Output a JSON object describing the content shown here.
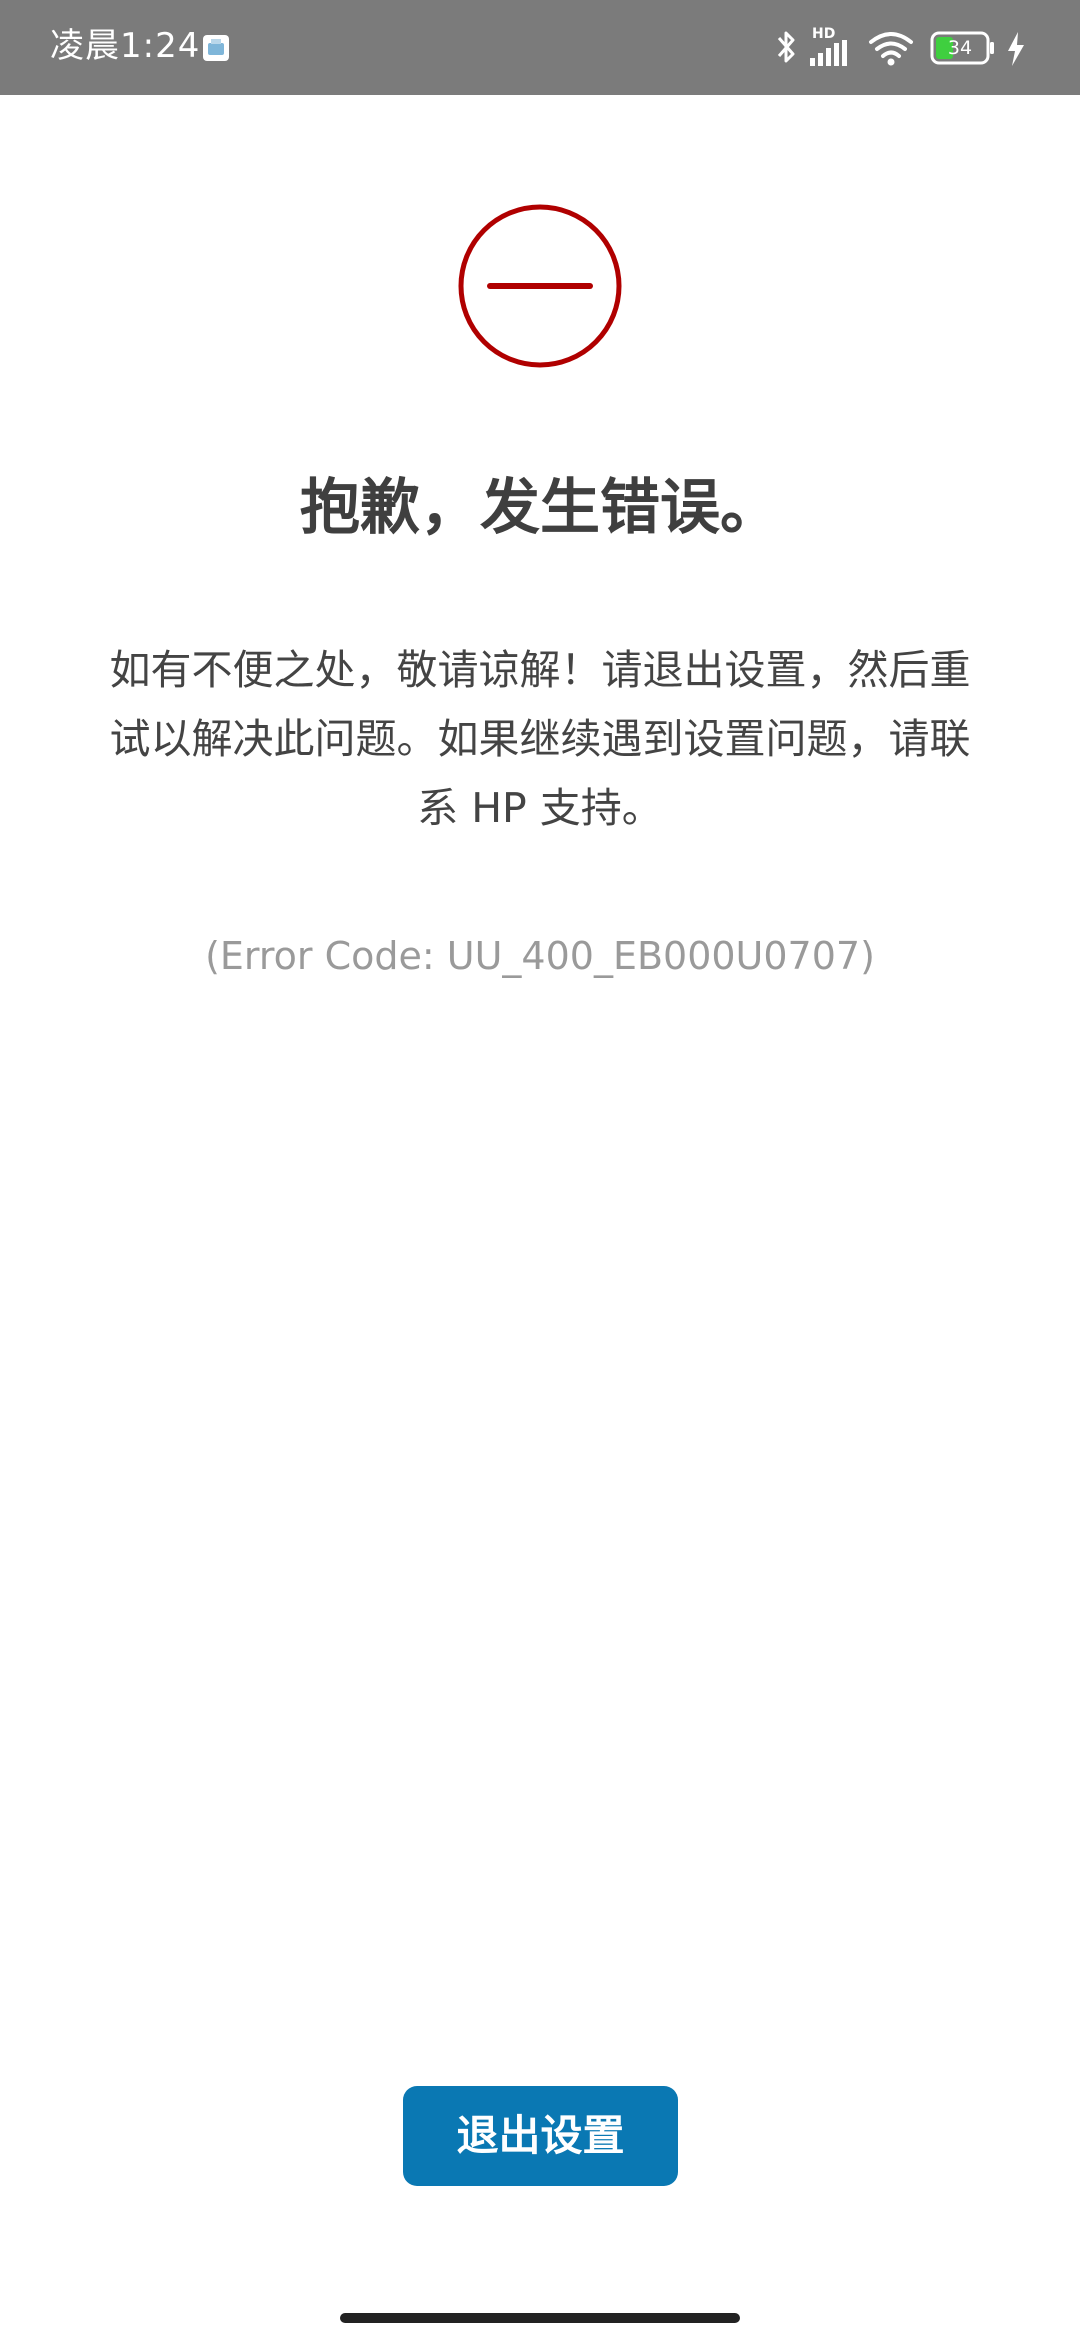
{
  "status_bar": {
    "time": "凌晨1:24",
    "battery_level": "34",
    "network_label": "HD",
    "icons": [
      "notification-app-icon",
      "bluetooth-icon",
      "signal-icon",
      "wifi-icon",
      "battery-icon",
      "charging-icon"
    ],
    "battery_color": "#3fcf3f"
  },
  "error": {
    "icon": "minus-circle-icon",
    "icon_color": "#b00000",
    "title": "抱歉，发生错误。",
    "message": "如有不便之处，敬请谅解！请退出设置，然后重试以解决此问题。如果继续遇到设置问题，请联系 HP 支持。",
    "code": "(Error Code: UU_400_EB000U0707)"
  },
  "actions": {
    "exit_label": "退出设置",
    "button_color": "#0a78b3"
  }
}
